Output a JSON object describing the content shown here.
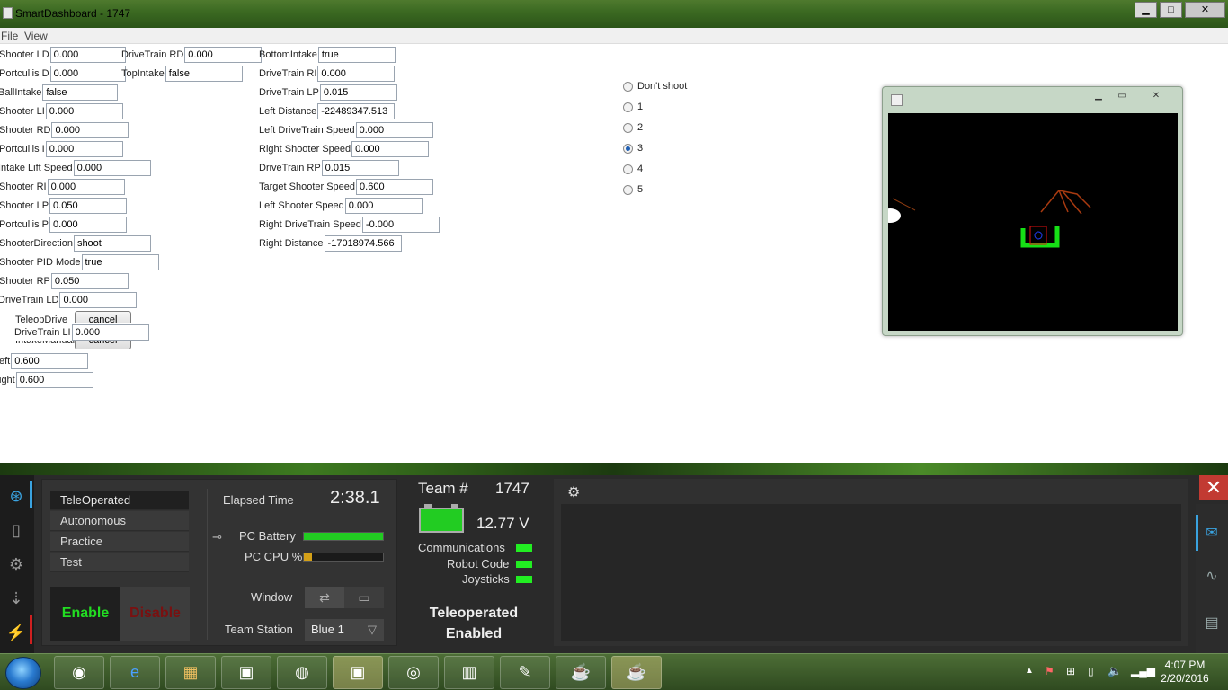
{
  "window": {
    "title": "SmartDashboard - 1747",
    "minimize": "▁",
    "maximize": "□",
    "close": "✕"
  },
  "menu": [
    "File",
    "View"
  ],
  "fields_left": [
    {
      "label": "Shooter LD",
      "value": "0.000"
    },
    {
      "label": "Portcullis D",
      "value": "0.000"
    },
    {
      "label": "BallIntake",
      "value": "false"
    },
    {
      "label": "Shooter LI",
      "value": "0.000"
    },
    {
      "label": "Shooter RD",
      "value": "0.000"
    },
    {
      "label": "Portcullis I",
      "value": "0.000"
    },
    {
      "label": "Intake Lift Speed",
      "value": "0.000"
    },
    {
      "label": "Shooter RI",
      "value": "0.000"
    },
    {
      "label": "Shooter LP",
      "value": "0.050"
    },
    {
      "label": "Portcullis P",
      "value": "0.000"
    },
    {
      "label": "ShooterDirection",
      "value": "shoot"
    },
    {
      "label": "Shooter PID Mode",
      "value": "true"
    },
    {
      "label": "Shooter RP",
      "value": "0.050"
    },
    {
      "label": "DriveTrain LD",
      "value": "0.000"
    }
  ],
  "fields_mid": [
    {
      "label": "DriveTrain RD",
      "value": "0.000"
    },
    {
      "label": "TopIntake",
      "value": "false"
    }
  ],
  "fields_right": [
    {
      "label": "BottomIntake",
      "value": "true"
    },
    {
      "label": "DriveTrain RI",
      "value": "0.000"
    },
    {
      "label": "DriveTrain LP",
      "value": "0.015"
    },
    {
      "label": "Left Distance",
      "value": "-22489347.513"
    },
    {
      "label": "Left DriveTrain Speed",
      "value": "0.000"
    },
    {
      "label": "Right Shooter Speed",
      "value": "0.000"
    },
    {
      "label": "DriveTrain RP",
      "value": "0.015"
    },
    {
      "label": "Target Shooter Speed",
      "value": "0.600"
    },
    {
      "label": "Left Shooter Speed",
      "value": "0.000"
    },
    {
      "label": "Right DriveTrain Speed",
      "value": "-0.000"
    },
    {
      "label": "Right Distance",
      "value": "-17018974.566"
    }
  ],
  "commands": [
    {
      "label": "TeleopDrive",
      "button": "cancel"
    },
    {
      "label": "IntakeManual",
      "button": "cancel"
    }
  ],
  "field_dtli": {
    "label": "DriveTrain LI",
    "value": "0.000"
  },
  "field_left": {
    "label": "eft",
    "value": "0.600"
  },
  "field_right": {
    "label": "ight",
    "value": "0.600"
  },
  "shoot_options": [
    "Don't shoot",
    "1",
    "2",
    "3",
    "4",
    "5"
  ],
  "shoot_selected": "3",
  "driver_station": {
    "modes": [
      "TeleOperated",
      "Autonomous",
      "Practice",
      "Test"
    ],
    "selected_mode": "TeleOperated",
    "enable": "Enable",
    "disable": "Disable",
    "elapsed_label": "Elapsed Time",
    "elapsed": "2:38.1",
    "pc_battery_label": "PC Battery",
    "pc_battery_level": 1.0,
    "pc_cpu_label": "PC CPU %",
    "pc_cpu_level": 0.1,
    "window_label": "Window",
    "team_station_label": "Team Station",
    "team_station": "Blue 1",
    "team_label": "Team #",
    "team_number": "1747",
    "voltage": "12.77 V",
    "indicators": [
      "Communications",
      "Robot Code",
      "Joysticks"
    ],
    "status_line1": "Teleoperated",
    "status_line2": "Enabled",
    "accent": "#22dd22",
    "close": "✕"
  },
  "taskbar": {
    "time": "4:07 PM",
    "date": "2/20/2016"
  }
}
